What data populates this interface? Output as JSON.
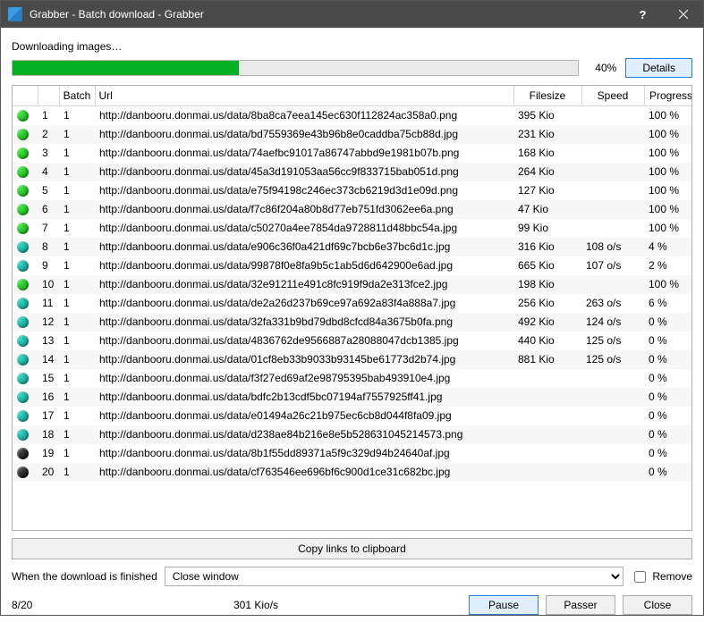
{
  "window": {
    "title": "Grabber - Batch download - Grabber",
    "help_icon": "?",
    "close_icon": "✕"
  },
  "status_label": "Downloading images…",
  "progress": {
    "percent": 40,
    "percent_label": "40%",
    "details_label": "Details"
  },
  "table": {
    "headers": {
      "status": "",
      "num": "",
      "batch": "Batch",
      "url": "Url",
      "filesize": "Filesize",
      "speed": "Speed",
      "progression": "Progression"
    },
    "rows": [
      {
        "status": "green",
        "num": "1",
        "batch": "1",
        "url": "http://danbooru.donmai.us/data/8ba8ca7eea145ec630f112824ac358a0.png",
        "filesize": "395 Kio",
        "speed": "",
        "prog": "100 %"
      },
      {
        "status": "green",
        "num": "2",
        "batch": "1",
        "url": "http://danbooru.donmai.us/data/bd7559369e43b96b8e0caddba75cb88d.jpg",
        "filesize": "231 Kio",
        "speed": "",
        "prog": "100 %"
      },
      {
        "status": "green",
        "num": "3",
        "batch": "1",
        "url": "http://danbooru.donmai.us/data/74aefbc91017a86747abbd9e1981b07b.png",
        "filesize": "168 Kio",
        "speed": "",
        "prog": "100 %"
      },
      {
        "status": "green",
        "num": "4",
        "batch": "1",
        "url": "http://danbooru.donmai.us/data/45a3d191053aa56cc9f833715bab051d.png",
        "filesize": "264 Kio",
        "speed": "",
        "prog": "100 %"
      },
      {
        "status": "green",
        "num": "5",
        "batch": "1",
        "url": "http://danbooru.donmai.us/data/e75f94198c246ec373cb6219d3d1e09d.png",
        "filesize": "127 Kio",
        "speed": "",
        "prog": "100 %"
      },
      {
        "status": "green",
        "num": "6",
        "batch": "1",
        "url": "http://danbooru.donmai.us/data/f7c86f204a80b8d77eb751fd3062ee6a.png",
        "filesize": "47 Kio",
        "speed": "",
        "prog": "100 %"
      },
      {
        "status": "green",
        "num": "7",
        "batch": "1",
        "url": "http://danbooru.donmai.us/data/c50270a4ee7854da9728811d48bbc54a.jpg",
        "filesize": "99 Kio",
        "speed": "",
        "prog": "100 %"
      },
      {
        "status": "teal",
        "num": "8",
        "batch": "1",
        "url": "http://danbooru.donmai.us/data/e906c36f0a421df69c7bcb6e37bc6d1c.jpg",
        "filesize": "316 Kio",
        "speed": "108 o/s",
        "prog": "4 %"
      },
      {
        "status": "teal",
        "num": "9",
        "batch": "1",
        "url": "http://danbooru.donmai.us/data/99878f0e8fa9b5c1ab5d6d642900e6ad.jpg",
        "filesize": "665 Kio",
        "speed": "107 o/s",
        "prog": "2 %"
      },
      {
        "status": "green",
        "num": "10",
        "batch": "1",
        "url": "http://danbooru.donmai.us/data/32e91211e491c8fc919f9da2e313fce2.jpg",
        "filesize": "198 Kio",
        "speed": "",
        "prog": "100 %"
      },
      {
        "status": "teal",
        "num": "11",
        "batch": "1",
        "url": "http://danbooru.donmai.us/data/de2a26d237b69ce97a692a83f4a888a7.jpg",
        "filesize": "256 Kio",
        "speed": "263 o/s",
        "prog": "6 %"
      },
      {
        "status": "teal",
        "num": "12",
        "batch": "1",
        "url": "http://danbooru.donmai.us/data/32fa331b9bd79dbd8cfcd84a3675b0fa.png",
        "filesize": "492 Kio",
        "speed": "124 o/s",
        "prog": "0 %"
      },
      {
        "status": "teal",
        "num": "13",
        "batch": "1",
        "url": "http://danbooru.donmai.us/data/4836762de9566887a28088047dcb1385.jpg",
        "filesize": "440 Kio",
        "speed": "125 o/s",
        "prog": "0 %"
      },
      {
        "status": "teal",
        "num": "14",
        "batch": "1",
        "url": "http://danbooru.donmai.us/data/01cf8eb33b9033b93145be61773d2b74.jpg",
        "filesize": "881 Kio",
        "speed": "125 o/s",
        "prog": "0 %"
      },
      {
        "status": "teal",
        "num": "15",
        "batch": "1",
        "url": "http://danbooru.donmai.us/data/f3f27ed69af2e98795395bab493910e4.jpg",
        "filesize": "",
        "speed": "",
        "prog": "0 %"
      },
      {
        "status": "teal",
        "num": "16",
        "batch": "1",
        "url": "http://danbooru.donmai.us/data/bdfc2b13cdf5bc07194af7557925ff41.jpg",
        "filesize": "",
        "speed": "",
        "prog": "0 %"
      },
      {
        "status": "teal",
        "num": "17",
        "batch": "1",
        "url": "http://danbooru.donmai.us/data/e01494a26c21b975ec6cb8d044f8fa09.jpg",
        "filesize": "",
        "speed": "",
        "prog": "0 %"
      },
      {
        "status": "teal",
        "num": "18",
        "batch": "1",
        "url": "http://danbooru.donmai.us/data/d238ae84b216e8e5b528631045214573.png",
        "filesize": "",
        "speed": "",
        "prog": "0 %"
      },
      {
        "status": "black",
        "num": "19",
        "batch": "1",
        "url": "http://danbooru.donmai.us/data/8b1f55dd89371a5f9c329d94b24640af.jpg",
        "filesize": "",
        "speed": "",
        "prog": "0 %"
      },
      {
        "status": "black",
        "num": "20",
        "batch": "1",
        "url": "http://danbooru.donmai.us/data/cf763546ee696bf6c900d1ce31c682bc.jpg",
        "filesize": "",
        "speed": "",
        "prog": "0 %"
      }
    ]
  },
  "copy_button": "Copy links to clipboard",
  "finish": {
    "label": "When the download is finished",
    "selected": "Close window",
    "remove_label": "Remove"
  },
  "footer": {
    "counter": "8/20",
    "speed": "301 Kio/s",
    "pause": "Pause",
    "passer": "Passer",
    "close": "Close"
  }
}
